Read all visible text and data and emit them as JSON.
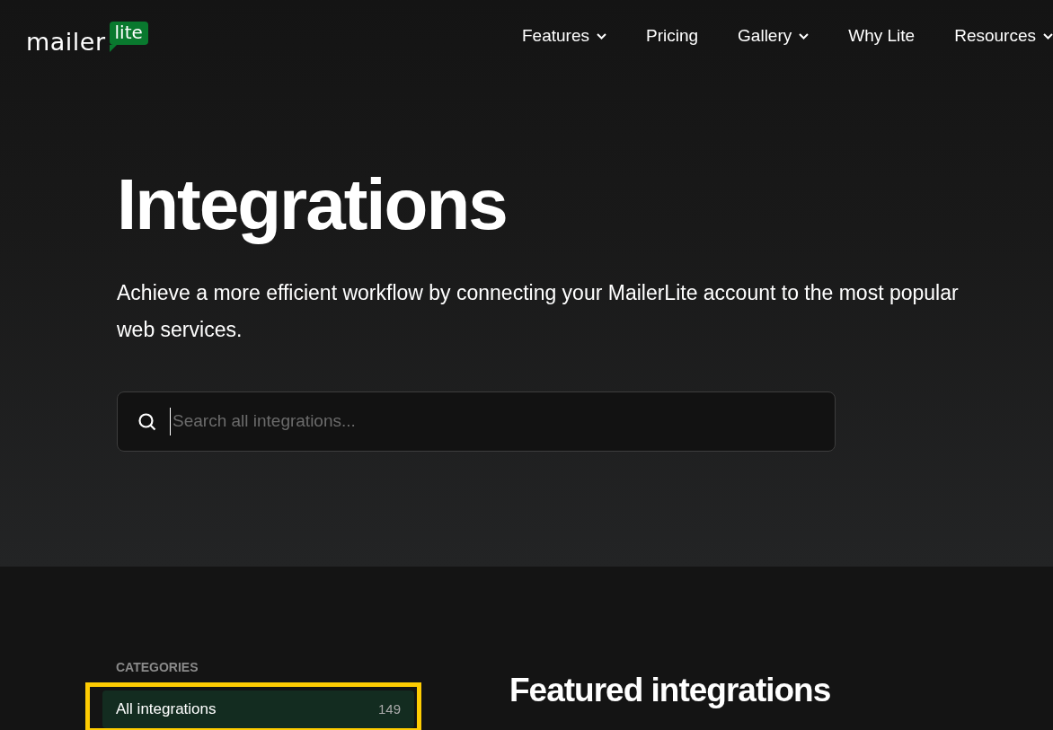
{
  "logo": {
    "word": "mailer",
    "badge": "lite"
  },
  "nav": [
    {
      "label": "Features",
      "dropdown": true
    },
    {
      "label": "Pricing",
      "dropdown": false
    },
    {
      "label": "Gallery",
      "dropdown": true
    },
    {
      "label": "Why Lite",
      "dropdown": false
    },
    {
      "label": "Resources",
      "dropdown": true
    }
  ],
  "hero": {
    "title": "Integrations",
    "subtitle": "Achieve a more efficient workflow by connecting your MailerLite account to the most popular web services.",
    "search": {
      "placeholder": "Search all integrations..."
    }
  },
  "sidebar": {
    "heading": "CATEGORIES",
    "items": [
      {
        "label": "All integrations",
        "count": "149",
        "selected": true,
        "highlighted": true
      }
    ]
  },
  "main": {
    "heading": "Featured integrations"
  }
}
